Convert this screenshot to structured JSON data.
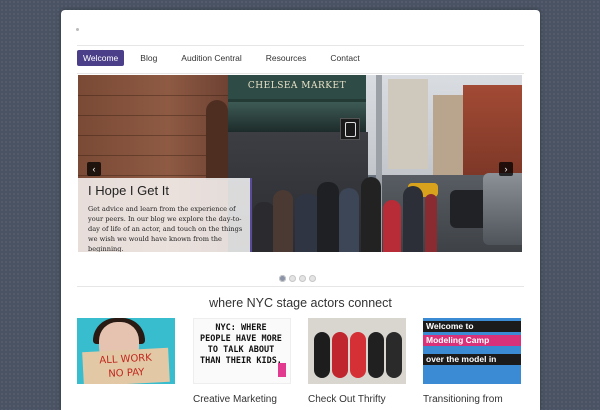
{
  "nav": {
    "items": [
      "Welcome",
      "Blog",
      "Audition Central",
      "Resources",
      "Contact"
    ],
    "active": "Welcome"
  },
  "slider": {
    "sign_text": "CHELSEA MARKET",
    "caption_title": "I Hope I Get It",
    "caption_text": "Get advice and learn from the experience of your peers. In our blog we explore the day-to-day of life of an actor, and touch on the things we wish we would have known from the beginning.",
    "prev_label": "‹",
    "next_label": "›",
    "slide_count": 4,
    "active_slide": 1
  },
  "tagline": "where NYC stage actors connect",
  "thumbs": [
    {
      "title": "",
      "sign_line1": "ALL WORK",
      "sign_line2": "NO PAY"
    },
    {
      "title": "Creative Marketing",
      "image_text": "NYC: WHERE PEOPLE HAVE MORE TO TALK ABOUT THAN THEIR KIDS."
    },
    {
      "title": "Check Out Thrifty"
    },
    {
      "title": "Transitioning from",
      "line1": "Welcome to",
      "line2": "Modeling Camp",
      "line3": "over the model in"
    }
  ],
  "colors": {
    "accent": "#4b3f8a",
    "background": "#4a5363"
  }
}
